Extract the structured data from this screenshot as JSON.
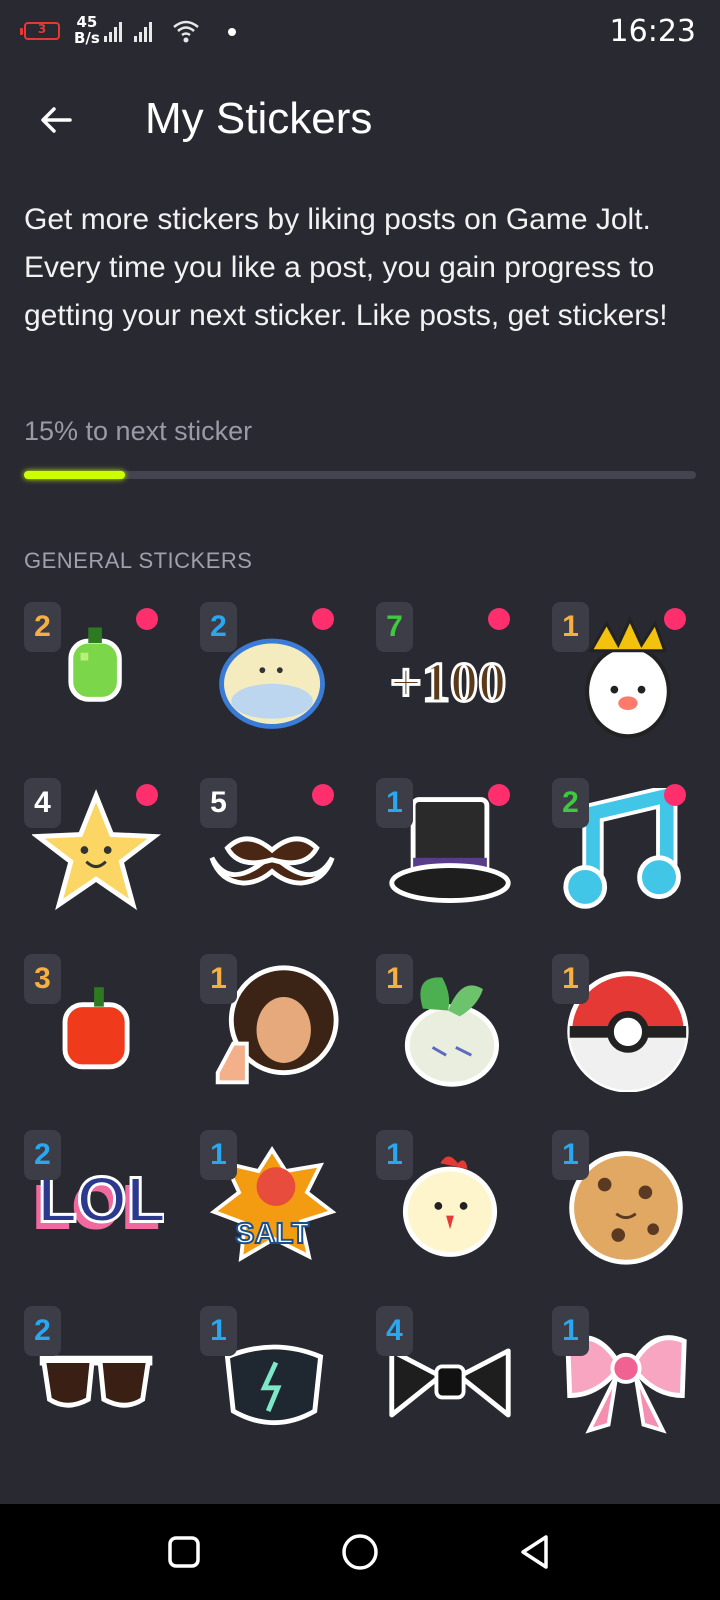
{
  "status": {
    "battery": "3",
    "net_speed": "45",
    "net_unit": "B/s",
    "time": "16:23"
  },
  "header": {
    "title": "My Stickers"
  },
  "description": "Get more stickers by liking posts on Game Jolt. Every time you like a post, you gain progress to getting your next sticker. Like posts, get stickers!",
  "progress": {
    "label": "15% to next sticker",
    "value_percent": 15
  },
  "section_title": "GENERAL STICKERS",
  "colors": {
    "background": "#292932",
    "progress": "#ccff00",
    "new_dot": "#ff2e6d",
    "count_orange": "#f5b041",
    "count_blue": "#29a8f0",
    "count_green": "#3fc93f",
    "count_white": "#ffffff"
  },
  "stickers": [
    {
      "count": "2",
      "icon": "green-melon-icon",
      "new": true
    },
    {
      "count": "2",
      "icon": "cream-bun-icon",
      "new": true
    },
    {
      "count": "7",
      "icon": "plus-100-icon",
      "new": true
    },
    {
      "count": "1",
      "icon": "king-face-icon",
      "new": true
    },
    {
      "count": "4",
      "icon": "star-icon",
      "new": true
    },
    {
      "count": "5",
      "icon": "mustache-icon",
      "new": true
    },
    {
      "count": "1",
      "icon": "top-hat-icon",
      "new": true
    },
    {
      "count": "2",
      "icon": "music-note-icon",
      "new": true
    },
    {
      "count": "3",
      "icon": "red-apple-icon",
      "new": false
    },
    {
      "count": "1",
      "icon": "painter-thumbs-up-icon",
      "new": false
    },
    {
      "count": "1",
      "icon": "turnip-icon",
      "new": false
    },
    {
      "count": "1",
      "icon": "pokeball-icon",
      "new": false
    },
    {
      "count": "2",
      "icon": "lol-icon",
      "new": false
    },
    {
      "count": "1",
      "icon": "salt-icon",
      "new": false
    },
    {
      "count": "1",
      "icon": "chick-icon",
      "new": false
    },
    {
      "count": "1",
      "icon": "cookie-icon",
      "new": false
    },
    {
      "count": "2",
      "icon": "sunglasses-icon",
      "new": false
    },
    {
      "count": "1",
      "icon": "face-mask-icon",
      "new": false
    },
    {
      "count": "4",
      "icon": "bow-tie-icon",
      "new": false
    },
    {
      "count": "1",
      "icon": "pink-bow-icon",
      "new": false
    }
  ]
}
